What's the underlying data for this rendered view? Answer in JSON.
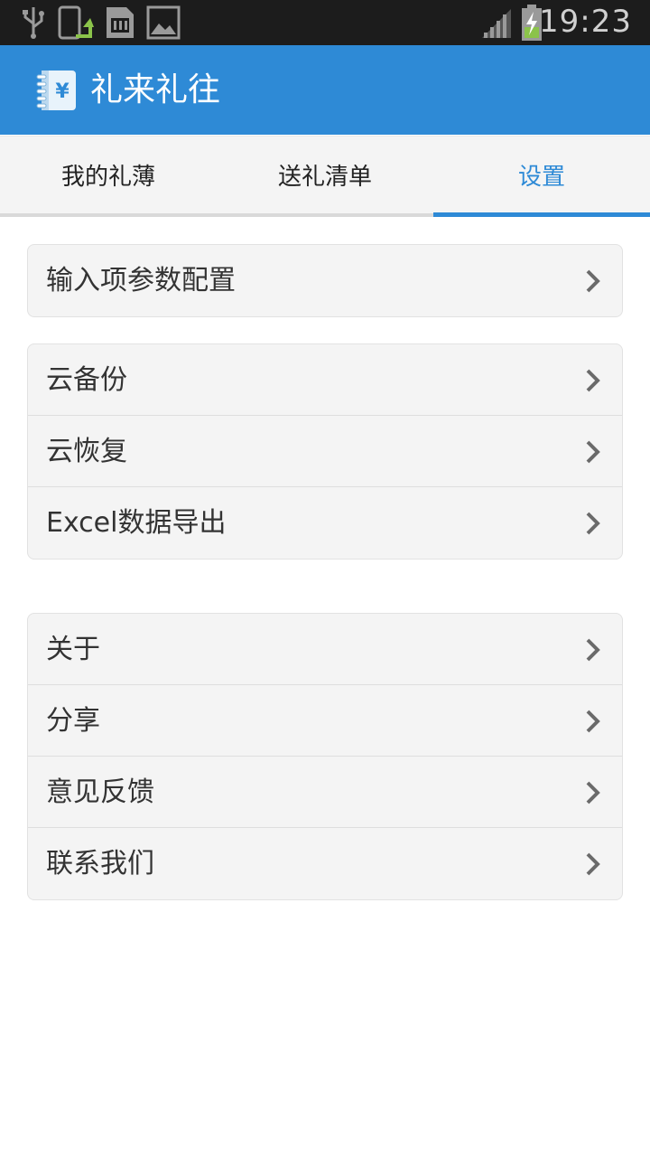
{
  "status_bar": {
    "time": "19:23",
    "icons": [
      "usb-icon",
      "phone-upload-icon",
      "sd-card-icon",
      "image-icon",
      "signal-icon",
      "battery-charging-icon"
    ]
  },
  "app_bar": {
    "title": "礼来礼往",
    "logo_icon": "notebook-yen-icon",
    "brand_color": "#2e8ad6"
  },
  "tabs": [
    {
      "label": "我的礼薄",
      "active": false
    },
    {
      "label": "送礼清单",
      "active": false
    },
    {
      "label": "设置",
      "active": true
    }
  ],
  "settings": {
    "group1": [
      {
        "label": "输入项参数配置"
      }
    ],
    "group2": [
      {
        "label": "云备份"
      },
      {
        "label": "云恢复"
      },
      {
        "label": "Excel数据导出"
      }
    ],
    "group3": [
      {
        "label": "关于"
      },
      {
        "label": "分享"
      },
      {
        "label": "意见反馈"
      },
      {
        "label": "联系我们"
      }
    ],
    "chevron_icon": "chevron-right-icon"
  }
}
